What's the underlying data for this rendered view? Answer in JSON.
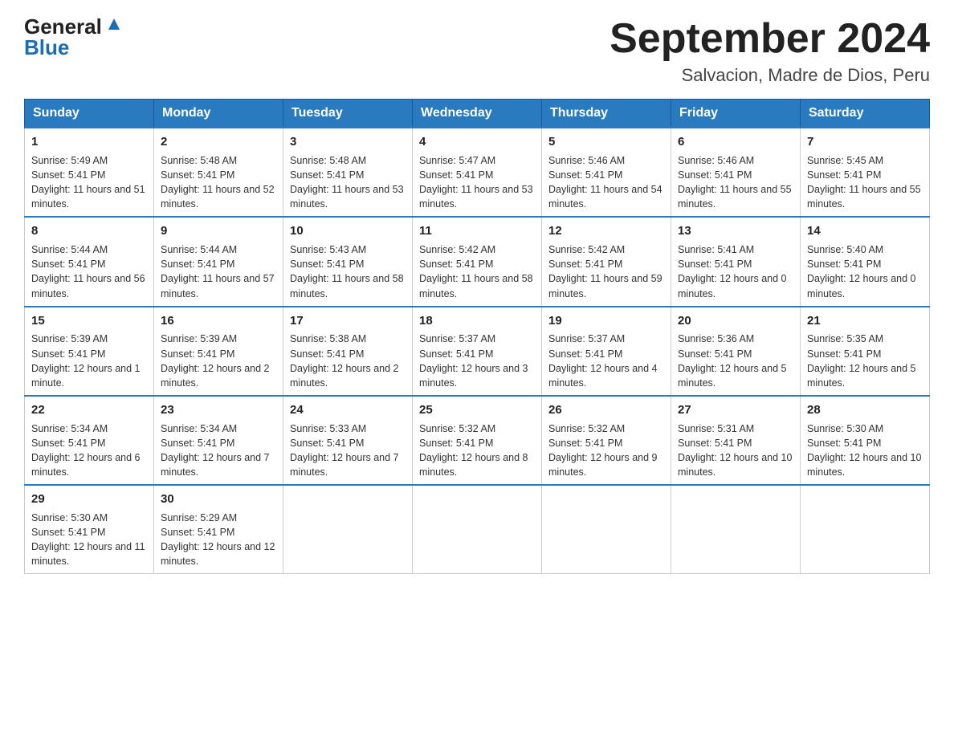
{
  "logo": {
    "general": "General",
    "blue": "Blue"
  },
  "header": {
    "month_year": "September 2024",
    "location": "Salvacion, Madre de Dios, Peru"
  },
  "days_of_week": [
    "Sunday",
    "Monday",
    "Tuesday",
    "Wednesday",
    "Thursday",
    "Friday",
    "Saturday"
  ],
  "weeks": [
    [
      {
        "day": "1",
        "sunrise": "5:49 AM",
        "sunset": "5:41 PM",
        "daylight": "11 hours and 51 minutes."
      },
      {
        "day": "2",
        "sunrise": "5:48 AM",
        "sunset": "5:41 PM",
        "daylight": "11 hours and 52 minutes."
      },
      {
        "day": "3",
        "sunrise": "5:48 AM",
        "sunset": "5:41 PM",
        "daylight": "11 hours and 53 minutes."
      },
      {
        "day": "4",
        "sunrise": "5:47 AM",
        "sunset": "5:41 PM",
        "daylight": "11 hours and 53 minutes."
      },
      {
        "day": "5",
        "sunrise": "5:46 AM",
        "sunset": "5:41 PM",
        "daylight": "11 hours and 54 minutes."
      },
      {
        "day": "6",
        "sunrise": "5:46 AM",
        "sunset": "5:41 PM",
        "daylight": "11 hours and 55 minutes."
      },
      {
        "day": "7",
        "sunrise": "5:45 AM",
        "sunset": "5:41 PM",
        "daylight": "11 hours and 55 minutes."
      }
    ],
    [
      {
        "day": "8",
        "sunrise": "5:44 AM",
        "sunset": "5:41 PM",
        "daylight": "11 hours and 56 minutes."
      },
      {
        "day": "9",
        "sunrise": "5:44 AM",
        "sunset": "5:41 PM",
        "daylight": "11 hours and 57 minutes."
      },
      {
        "day": "10",
        "sunrise": "5:43 AM",
        "sunset": "5:41 PM",
        "daylight": "11 hours and 58 minutes."
      },
      {
        "day": "11",
        "sunrise": "5:42 AM",
        "sunset": "5:41 PM",
        "daylight": "11 hours and 58 minutes."
      },
      {
        "day": "12",
        "sunrise": "5:42 AM",
        "sunset": "5:41 PM",
        "daylight": "11 hours and 59 minutes."
      },
      {
        "day": "13",
        "sunrise": "5:41 AM",
        "sunset": "5:41 PM",
        "daylight": "12 hours and 0 minutes."
      },
      {
        "day": "14",
        "sunrise": "5:40 AM",
        "sunset": "5:41 PM",
        "daylight": "12 hours and 0 minutes."
      }
    ],
    [
      {
        "day": "15",
        "sunrise": "5:39 AM",
        "sunset": "5:41 PM",
        "daylight": "12 hours and 1 minute."
      },
      {
        "day": "16",
        "sunrise": "5:39 AM",
        "sunset": "5:41 PM",
        "daylight": "12 hours and 2 minutes."
      },
      {
        "day": "17",
        "sunrise": "5:38 AM",
        "sunset": "5:41 PM",
        "daylight": "12 hours and 2 minutes."
      },
      {
        "day": "18",
        "sunrise": "5:37 AM",
        "sunset": "5:41 PM",
        "daylight": "12 hours and 3 minutes."
      },
      {
        "day": "19",
        "sunrise": "5:37 AM",
        "sunset": "5:41 PM",
        "daylight": "12 hours and 4 minutes."
      },
      {
        "day": "20",
        "sunrise": "5:36 AM",
        "sunset": "5:41 PM",
        "daylight": "12 hours and 5 minutes."
      },
      {
        "day": "21",
        "sunrise": "5:35 AM",
        "sunset": "5:41 PM",
        "daylight": "12 hours and 5 minutes."
      }
    ],
    [
      {
        "day": "22",
        "sunrise": "5:34 AM",
        "sunset": "5:41 PM",
        "daylight": "12 hours and 6 minutes."
      },
      {
        "day": "23",
        "sunrise": "5:34 AM",
        "sunset": "5:41 PM",
        "daylight": "12 hours and 7 minutes."
      },
      {
        "day": "24",
        "sunrise": "5:33 AM",
        "sunset": "5:41 PM",
        "daylight": "12 hours and 7 minutes."
      },
      {
        "day": "25",
        "sunrise": "5:32 AM",
        "sunset": "5:41 PM",
        "daylight": "12 hours and 8 minutes."
      },
      {
        "day": "26",
        "sunrise": "5:32 AM",
        "sunset": "5:41 PM",
        "daylight": "12 hours and 9 minutes."
      },
      {
        "day": "27",
        "sunrise": "5:31 AM",
        "sunset": "5:41 PM",
        "daylight": "12 hours and 10 minutes."
      },
      {
        "day": "28",
        "sunrise": "5:30 AM",
        "sunset": "5:41 PM",
        "daylight": "12 hours and 10 minutes."
      }
    ],
    [
      {
        "day": "29",
        "sunrise": "5:30 AM",
        "sunset": "5:41 PM",
        "daylight": "12 hours and 11 minutes."
      },
      {
        "day": "30",
        "sunrise": "5:29 AM",
        "sunset": "5:41 PM",
        "daylight": "12 hours and 12 minutes."
      },
      null,
      null,
      null,
      null,
      null
    ]
  ],
  "labels": {
    "sunrise": "Sunrise:",
    "sunset": "Sunset:",
    "daylight": "Daylight:"
  }
}
